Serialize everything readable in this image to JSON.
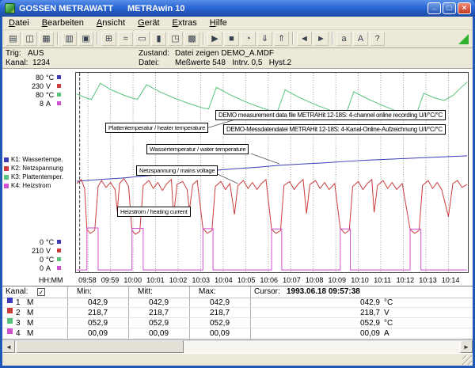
{
  "window": {
    "title_left": "GOSSEN METRAWATT",
    "title_right": "METRAwin 10",
    "min_glyph": "_",
    "max_glyph": "□",
    "close_glyph": "×"
  },
  "colors": {
    "titlebar": "#2a66d4",
    "chrome": "#ece9d8",
    "k1_blue": "#3c3cb8",
    "k2_red": "#cb3b3b",
    "k3_green": "#55c47a",
    "k4_magenta": "#cf4fcf",
    "grid": "#9a9a9a",
    "live_triangle": "#2fae2f"
  },
  "menu": {
    "items": [
      {
        "label": "Datei",
        "u": 0
      },
      {
        "label": "Bearbeiten",
        "u": 0
      },
      {
        "label": "Ansicht",
        "u": 0
      },
      {
        "label": "Gerät",
        "u": 0
      },
      {
        "label": "Extras",
        "u": 0
      },
      {
        "label": "Hilfe",
        "u": 0
      }
    ]
  },
  "toolbar": {
    "groups": [
      [
        {
          "name": "open-file-icon",
          "glyph": "▤"
        },
        {
          "name": "save-file-icon",
          "glyph": "◫"
        },
        {
          "name": "export-file-icon",
          "glyph": "▦"
        }
      ],
      [
        {
          "name": "print-icon",
          "glyph": "▥"
        },
        {
          "name": "copy-icon",
          "glyph": "▣"
        }
      ],
      [
        {
          "name": "table-view-icon",
          "glyph": "⊞"
        },
        {
          "name": "curve-view-icon",
          "glyph": "≈"
        },
        {
          "name": "digital-view-icon",
          "glyph": "▭"
        },
        {
          "name": "bar-view-icon",
          "glyph": "▮"
        },
        {
          "name": "xy-view-icon",
          "glyph": "◳"
        },
        {
          "name": "statistics-view-icon",
          "glyph": "▩"
        }
      ],
      [
        {
          "name": "start-record-icon",
          "glyph": "▶"
        },
        {
          "name": "stop-record-icon",
          "glyph": "■"
        },
        {
          "name": "clock-icon",
          "glyph": "◔"
        },
        {
          "name": "read-device-icon",
          "glyph": "⇓"
        },
        {
          "name": "send-device-icon",
          "glyph": "⇑"
        }
      ],
      [
        {
          "name": "scroll-left-mode-icon",
          "glyph": "◄"
        },
        {
          "name": "scroll-right-mode-icon",
          "glyph": "►"
        }
      ],
      [
        {
          "name": "zoom-out-icon",
          "glyph": "a"
        },
        {
          "name": "zoom-in-icon",
          "glyph": "A"
        },
        {
          "name": "help-pointer-icon",
          "glyph": "?"
        }
      ]
    ]
  },
  "status": {
    "trig_label": "Trig:",
    "trig_value": "AUS",
    "kanal_label": "Kanal:",
    "kanal_value": "1234",
    "zustand_label": "Zustand:",
    "zustand_value": "Datei zeigen DEMO_A.MDF",
    "datei_label": "Datei:",
    "datei_value": "Meßwerte 548   Intrv. 0,5   Hyst.2"
  },
  "chart_data": {
    "type": "line",
    "title": "",
    "x_axis_label": "HH:MM",
    "x_start_time": "09:57:30",
    "x_range_minutes": [
      0,
      17.33
    ],
    "x_tick_interval_min": 1,
    "x_ticks": [
      "09:58",
      "09:59",
      "10:00",
      "10:01",
      "10:02",
      "10:03",
      "10:04",
      "10:05",
      "10:06",
      "10:07",
      "10:08",
      "10:09",
      "10:10",
      "10:11",
      "10:12",
      "10:13",
      "10:14"
    ],
    "grid": "vertical-dotted",
    "legend_position": "left",
    "cursor_time": "1993.06.18 09:57:38",
    "cursor_t": 0.13,
    "axes_left_top": [
      {
        "value": "80",
        "unit": "°C",
        "color": "#3c3cb8"
      },
      {
        "value": "230",
        "unit": "V",
        "color": "#cb3b3b"
      },
      {
        "value": "80",
        "unit": "°C",
        "color": "#55c47a"
      },
      {
        "value": "8",
        "unit": "A",
        "color": "#cf4fcf"
      }
    ],
    "axes_left_bottom": [
      {
        "value": "0",
        "unit": "°C",
        "color": "#3c3cb8"
      },
      {
        "value": "210",
        "unit": "V",
        "color": "#cb3b3b"
      },
      {
        "value": "0",
        "unit": "°C",
        "color": "#55c47a"
      },
      {
        "value": "0",
        "unit": "A",
        "color": "#cf4fcf"
      }
    ],
    "curve_labels": {
      "platten": "Plattentemperatur / heater temperature",
      "wasser": "Wassertemperatur / water temperature",
      "netz": "Netzspannung / mains voltage",
      "heiz": "Heizstrom / heating current"
    },
    "annotations": [
      "DEMO measurement data file METRAHit 12-18S: 4-channel online recording U/I/°C/°C",
      "DEMO-Messdatendatei METRAHit 12-18S: 4-Kanal-Online-Aufzeichnung U/I/°C/°C"
    ],
    "series": [
      {
        "channel": "K1",
        "name": "Wassertemperatur / water temperature",
        "unit": "°C",
        "color": "#3c3cb8",
        "scale": {
          "min": 0,
          "max": 80
        },
        "points": [
          [
            0,
            36.5
          ],
          [
            1,
            37.2
          ],
          [
            2,
            37.8
          ],
          [
            3,
            38.6
          ],
          [
            4,
            39.3
          ],
          [
            5,
            39.9
          ],
          [
            6,
            40.8
          ],
          [
            7,
            41.5
          ],
          [
            8,
            42.1
          ],
          [
            9,
            42.9
          ],
          [
            10,
            43.4
          ],
          [
            11,
            43.9
          ],
          [
            12,
            44.5
          ],
          [
            13,
            45.0
          ],
          [
            14,
            45.4
          ],
          [
            15,
            45.8
          ],
          [
            16,
            46.2
          ],
          [
            17.33,
            46.7
          ]
        ]
      },
      {
        "channel": "K2",
        "name": "Netzspannung / mains voltage",
        "unit": "V",
        "color": "#cb3b3b",
        "scale": {
          "min": 210,
          "max": 230
        },
        "points": [
          [
            0,
            218.9
          ],
          [
            0.2,
            219.3
          ],
          [
            0.35,
            218.4
          ],
          [
            0.45,
            214.3
          ],
          [
            0.6,
            213.9
          ],
          [
            0.8,
            214.2
          ],
          [
            0.95,
            218.6
          ],
          [
            1.1,
            219.2
          ],
          [
            1.3,
            218.5
          ],
          [
            1.5,
            219.0
          ],
          [
            1.7,
            218.3
          ],
          [
            1.8,
            216.1
          ],
          [
            1.9,
            218.9
          ],
          [
            2.1,
            219.4
          ],
          [
            2.3,
            218.6
          ],
          [
            2.45,
            214.2
          ],
          [
            2.6,
            213.8
          ],
          [
            2.8,
            214.1
          ],
          [
            2.95,
            218.7
          ],
          [
            3.2,
            219.2
          ],
          [
            3.4,
            218.4
          ],
          [
            3.6,
            219.0
          ],
          [
            3.8,
            218.2
          ],
          [
            4.0,
            218.9
          ],
          [
            4.2,
            219.3
          ],
          [
            4.3,
            215.6
          ],
          [
            4.45,
            218.8
          ],
          [
            4.7,
            219.1
          ],
          [
            4.9,
            218.3
          ],
          [
            5.0,
            216.2
          ],
          [
            5.15,
            218.8
          ],
          [
            5.35,
            219.2
          ],
          [
            5.6,
            214.4
          ],
          [
            5.8,
            213.9
          ],
          [
            6.0,
            214.2
          ],
          [
            6.15,
            218.6
          ],
          [
            6.4,
            219.1
          ],
          [
            6.6,
            218.3
          ],
          [
            6.8,
            218.9
          ],
          [
            7.0,
            215.8
          ],
          [
            7.15,
            218.7
          ],
          [
            7.4,
            219.2
          ],
          [
            7.6,
            218.4
          ],
          [
            7.8,
            219.0
          ],
          [
            8.0,
            218.3
          ],
          [
            8.2,
            218.9
          ],
          [
            8.4,
            219.3
          ],
          [
            8.65,
            214.3
          ],
          [
            8.85,
            213.9
          ],
          [
            9.05,
            214.2
          ],
          [
            9.2,
            218.7
          ],
          [
            9.45,
            219.1
          ],
          [
            9.65,
            218.3
          ],
          [
            9.85,
            218.9
          ],
          [
            10.05,
            219.3
          ],
          [
            10.2,
            215.9
          ],
          [
            10.35,
            218.8
          ],
          [
            10.6,
            219.2
          ],
          [
            10.8,
            218.4
          ],
          [
            11.0,
            219.0
          ],
          [
            11.2,
            218.3
          ],
          [
            11.45,
            218.9
          ],
          [
            11.7,
            214.4
          ],
          [
            11.9,
            213.9
          ],
          [
            12.1,
            214.2
          ],
          [
            12.25,
            218.6
          ],
          [
            12.5,
            219.1
          ],
          [
            12.7,
            218.3
          ],
          [
            12.9,
            218.9
          ],
          [
            13.1,
            219.3
          ],
          [
            13.2,
            216.0
          ],
          [
            13.35,
            218.7
          ],
          [
            13.6,
            219.2
          ],
          [
            13.8,
            218.4
          ],
          [
            14.0,
            219.0
          ],
          [
            14.2,
            218.3
          ],
          [
            14.45,
            218.9
          ],
          [
            14.8,
            214.3
          ],
          [
            15.0,
            213.9
          ],
          [
            15.2,
            214.2
          ],
          [
            15.35,
            218.7
          ],
          [
            15.6,
            219.2
          ],
          [
            15.8,
            218.4
          ],
          [
            16.0,
            219.0
          ],
          [
            16.2,
            218.3
          ],
          [
            16.5,
            215.6
          ],
          [
            16.7,
            218.9
          ],
          [
            16.9,
            219.2
          ],
          [
            17.1,
            218.5
          ],
          [
            17.33,
            218.8
          ]
        ]
      },
      {
        "channel": "K4",
        "name": "Heizstrom / heating current",
        "unit": "A",
        "color": "#cf4fcf",
        "scale": {
          "min": 0,
          "max": 8
        },
        "points": [
          [
            0,
            0.09
          ],
          [
            0.45,
            0.09
          ],
          [
            0.45,
            1.78
          ],
          [
            0.95,
            1.78
          ],
          [
            0.95,
            0.09
          ],
          [
            2.45,
            0.09
          ],
          [
            2.45,
            1.76
          ],
          [
            2.95,
            1.76
          ],
          [
            2.95,
            0.09
          ],
          [
            5.6,
            0.09
          ],
          [
            5.6,
            1.75
          ],
          [
            6.05,
            1.75
          ],
          [
            6.05,
            0.09
          ],
          [
            8.65,
            0.09
          ],
          [
            8.65,
            1.74
          ],
          [
            9.1,
            1.74
          ],
          [
            9.1,
            0.09
          ],
          [
            11.7,
            0.09
          ],
          [
            11.7,
            1.74
          ],
          [
            12.15,
            1.74
          ],
          [
            12.15,
            0.09
          ],
          [
            14.8,
            0.09
          ],
          [
            14.8,
            1.73
          ],
          [
            15.28,
            1.73
          ],
          [
            15.28,
            0.09
          ],
          [
            17.33,
            0.09
          ]
        ]
      },
      {
        "channel": "K3",
        "name": "Plattentemperatur / heater temperature",
        "unit": "°C",
        "color": "#55c47a",
        "scale": {
          "min": 0,
          "max": 80
        },
        "points": [
          [
            0,
            71.5
          ],
          [
            0.45,
            69.8
          ],
          [
            0.65,
            69.3
          ],
          [
            1.05,
            75.8
          ],
          [
            1.5,
            73.3
          ],
          [
            2.1,
            71.0
          ],
          [
            2.45,
            69.9
          ],
          [
            2.7,
            69.4
          ],
          [
            3.1,
            75.2
          ],
          [
            3.7,
            72.3
          ],
          [
            4.4,
            69.6
          ],
          [
            5.1,
            67.3
          ],
          [
            5.6,
            65.9
          ],
          [
            5.85,
            65.5
          ],
          [
            6.2,
            74.2
          ],
          [
            6.8,
            71.2
          ],
          [
            7.5,
            68.3
          ],
          [
            8.2,
            66.0
          ],
          [
            8.65,
            64.6
          ],
          [
            8.9,
            64.2
          ],
          [
            9.25,
            73.2
          ],
          [
            9.9,
            70.0
          ],
          [
            10.6,
            67.2
          ],
          [
            11.3,
            64.8
          ],
          [
            11.7,
            63.6
          ],
          [
            11.95,
            63.3
          ],
          [
            12.3,
            72.4
          ],
          [
            12.9,
            69.6
          ],
          [
            13.6,
            66.8
          ],
          [
            14.3,
            64.3
          ],
          [
            14.8,
            62.9
          ],
          [
            15.05,
            62.6
          ],
          [
            15.4,
            71.8
          ],
          [
            15.9,
            69.9
          ],
          [
            16.3,
            68.9
          ],
          [
            16.7,
            70.9
          ],
          [
            17.0,
            73.5
          ],
          [
            17.33,
            76.3
          ]
        ]
      }
    ]
  },
  "legend": {
    "items": [
      {
        "key": "K1:",
        "label": "Wassertempe.",
        "color": "#3c3cb8"
      },
      {
        "key": "K2:",
        "label": "Netzspannung",
        "color": "#cb3b3b"
      },
      {
        "key": "K3:",
        "label": "Plattentemper.",
        "color": "#55c47a"
      },
      {
        "key": "K4:",
        "label": "Heizstrom",
        "color": "#cf4fcf"
      }
    ]
  },
  "table": {
    "header": {
      "kanal": "Kanal:",
      "check": "✓",
      "min": "Min:",
      "mitt": "Mitt:",
      "max": "Max:",
      "cursor": "Cursor:",
      "cursor_value": "1993.06.18 09:57:38"
    },
    "rows": [
      {
        "num": "1",
        "mem": "M",
        "color": "#3c3cb8",
        "min": "042,9",
        "mitt": "042,9",
        "max": "042,9",
        "cursor": "042,9",
        "unit": "°C"
      },
      {
        "num": "2",
        "mem": "M",
        "color": "#cb3b3b",
        "min": "218,7",
        "mitt": "218,7",
        "max": "218,7",
        "cursor": "218,7",
        "unit": "V"
      },
      {
        "num": "3",
        "mem": "M",
        "color": "#55c47a",
        "min": "052,9",
        "mitt": "052,9",
        "max": "052,9",
        "cursor": "052,9",
        "unit": "°C"
      },
      {
        "num": "4",
        "mem": "M",
        "color": "#cf4fcf",
        "min": "00,09",
        "mitt": "00,09",
        "max": "00,09",
        "cursor": "00,09",
        "unit": "A"
      }
    ]
  },
  "scrollbar": {
    "left_glyph": "◄",
    "right_glyph": "►"
  }
}
